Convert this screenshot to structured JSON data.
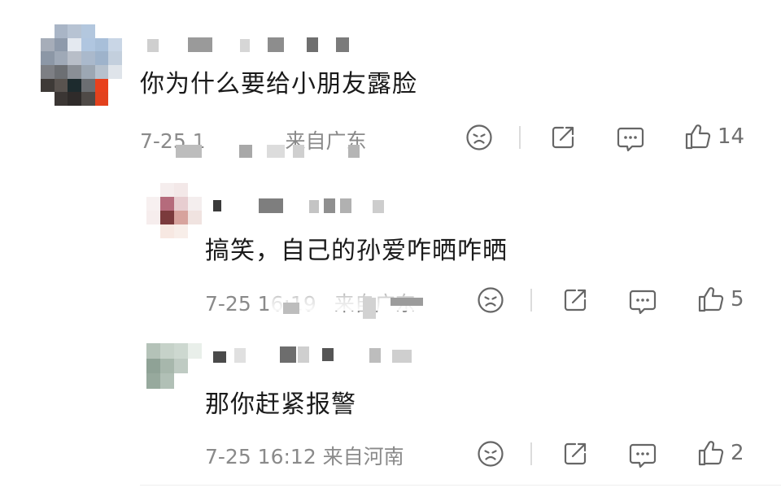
{
  "comments": [
    {
      "text": "你为什么要给小朋友露脸",
      "meta": "7-25 1",
      "meta_suffix": "来自广东",
      "likes": "14",
      "icons": {
        "dislike": "frown-icon",
        "share": "share-icon",
        "reply": "comment-icon",
        "like": "thumbs-up-icon"
      }
    }
  ],
  "replies": [
    {
      "text": "搞笑，自己的孙爱咋晒咋晒",
      "meta": "7-25 16:19",
      "meta_suffix": "来自广东",
      "likes": "5",
      "icons": {
        "dislike": "frown-icon",
        "share": "share-icon",
        "reply": "comment-icon",
        "like": "thumbs-up-icon"
      }
    },
    {
      "text": "那你赶紧报警",
      "meta": "7-25 16:12 来自河南",
      "likes": "2",
      "icons": {
        "dislike": "frown-icon",
        "share": "share-icon",
        "reply": "comment-icon",
        "like": "thumbs-up-icon"
      }
    }
  ],
  "colors": {
    "text": "#1a1a1a",
    "meta": "#8a8a8a",
    "icon": "#666666",
    "avatar_accent": "#e8401c"
  }
}
